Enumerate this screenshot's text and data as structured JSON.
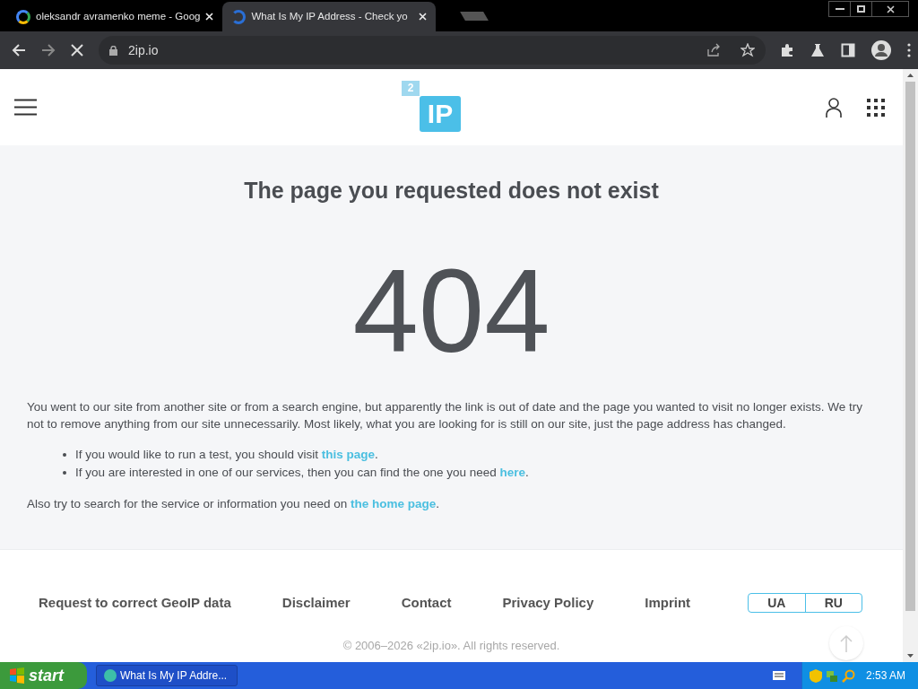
{
  "browser": {
    "tabs": [
      {
        "title": "oleksandr avramenko meme - Goog",
        "selected": false
      },
      {
        "title": "What Is My IP Address - Check yo",
        "selected": true
      }
    ],
    "address": "2ip.io"
  },
  "header": {
    "logo_small": "2",
    "logo": "IP"
  },
  "heading": "The page you requested does not exist",
  "code": "404",
  "intro": "You went to our site from another site or from a search engine, but apparently the link is out of date and the page you wanted to visit no longer exists. We try not to remove anything from our site unnecessarily. Most likely, what you are looking for is still on our site, just the page address has changed.",
  "bullets": [
    {
      "before": "If you would like to run a test, you should visit ",
      "link": "this page",
      "after": "."
    },
    {
      "before": "If you are interested in one of our services, then you can find the one you need ",
      "link": "here",
      "after": "."
    }
  ],
  "also": {
    "before": "Also try to search for the service or information you need on ",
    "link": "the home page",
    "after": "."
  },
  "footer": {
    "links": [
      "Request to correct GeoIP data",
      "Disclaimer",
      "Contact",
      "Privacy Policy",
      "Imprint"
    ],
    "languages": [
      "UA",
      "RU"
    ],
    "copyright": "© 2006–2026 «2ip.io». All rights reserved."
  },
  "taskbar": {
    "start": "start",
    "task": "What Is My IP Addre...",
    "clock": "2:53 AM"
  }
}
